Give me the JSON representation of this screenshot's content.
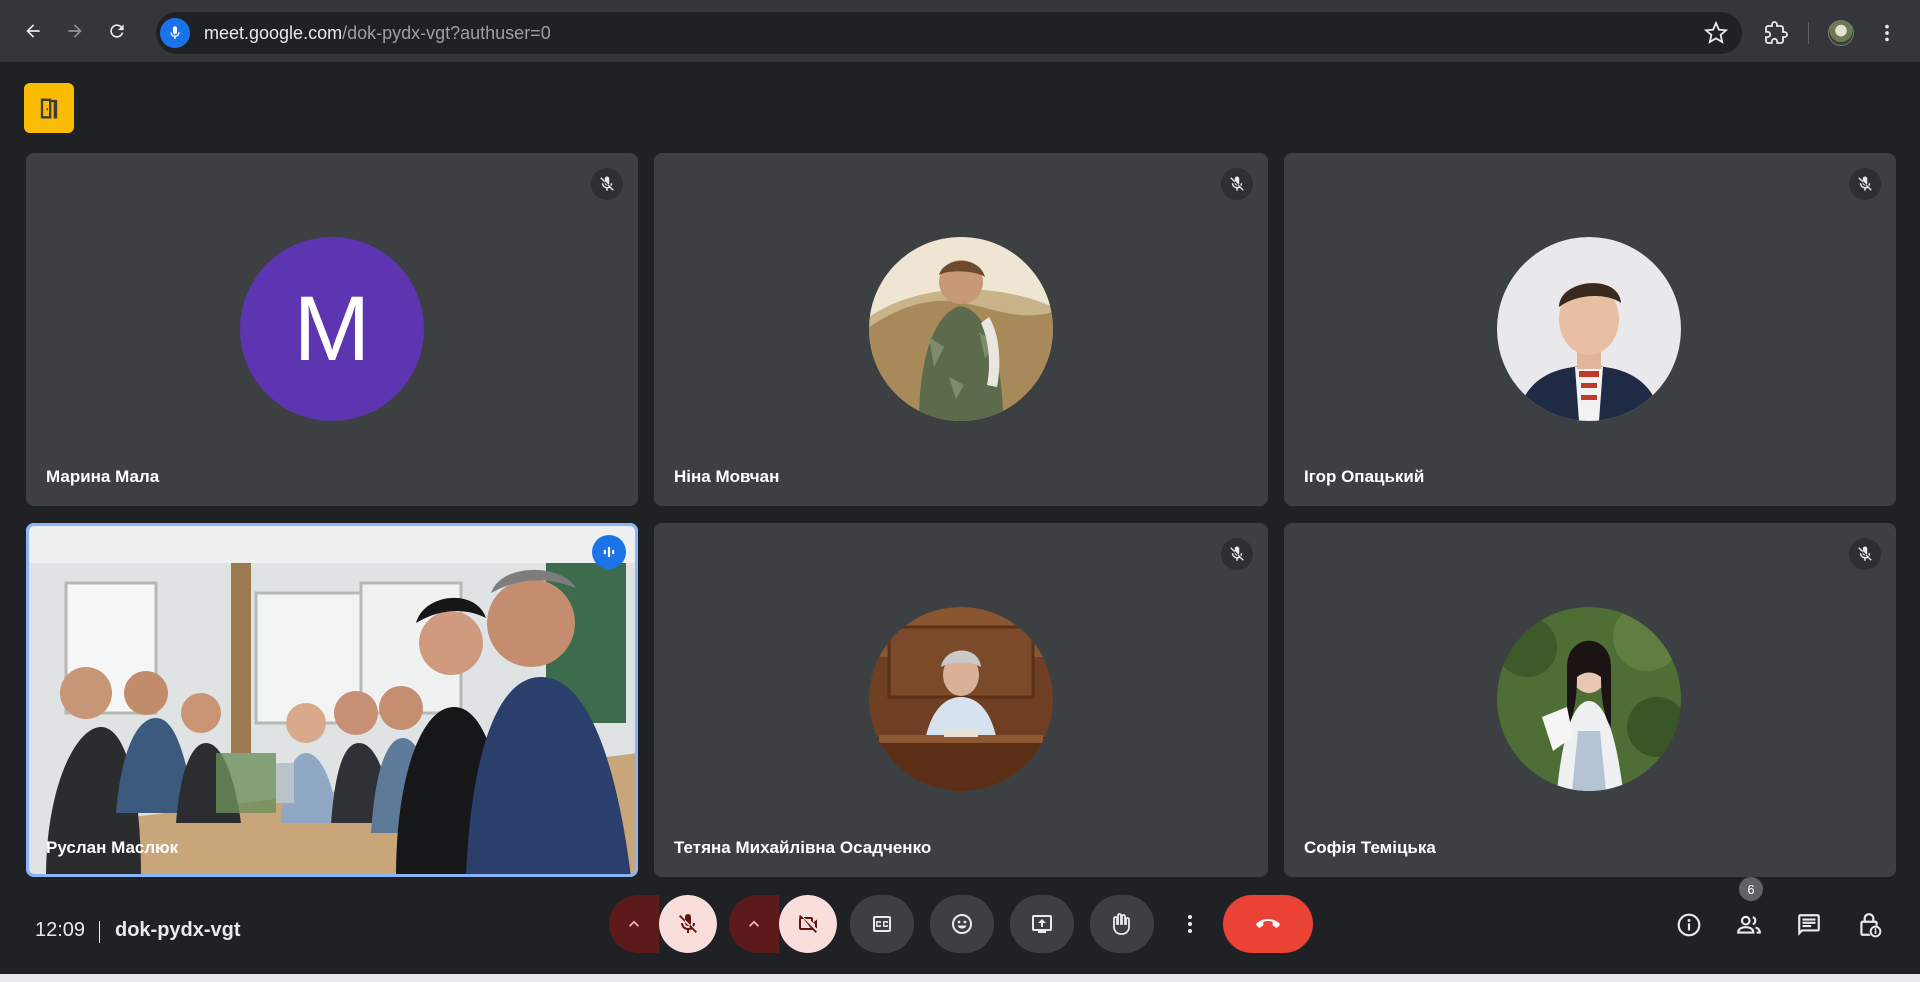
{
  "browser": {
    "url_host": "meet.google.com",
    "url_path": "/dok-pydx-vgt?authuser=0"
  },
  "meet": {
    "tiles": [
      {
        "name": "Марина Мала",
        "avatar_letter": "M",
        "muted": true
      },
      {
        "name": "Ніна Мовчан",
        "muted": true
      },
      {
        "name": "Ігор Опацький",
        "muted": true
      },
      {
        "name": "Руслан Маслюк",
        "speaking": true
      },
      {
        "name": "Тетяна Михайлівна Осадченко",
        "muted": true
      },
      {
        "name": "Софія Теміцька",
        "muted": true
      }
    ],
    "bottom_bar": {
      "clock": "12:09",
      "meeting_code": "dok-pydx-vgt",
      "participants_count": "6"
    }
  },
  "colors": {
    "meet_background": "#202124",
    "tile_background": "#3c4043",
    "avatar_purple": "#5e35b1",
    "hangup_red": "#ea4335",
    "accent_blue": "#1a73e8",
    "room_badge_yellow": "#fbbc04",
    "muted_control_bg": "#f9dedc"
  }
}
